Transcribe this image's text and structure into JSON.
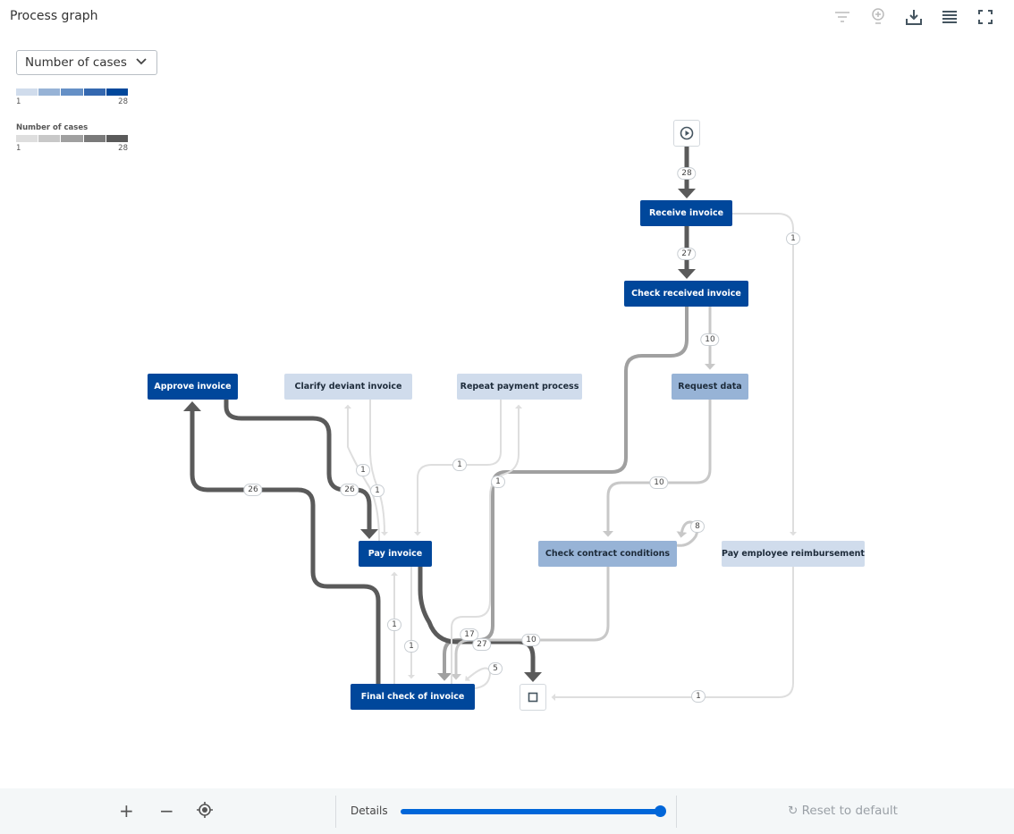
{
  "header": {
    "title": "Process graph",
    "tools": [
      "filter-icon",
      "lightbulb-icon",
      "download-icon",
      "list-icon",
      "fullscreen-icon"
    ]
  },
  "metric_select": {
    "value": "Number of cases"
  },
  "node_legend": {
    "min": "1",
    "max": "28",
    "colors": [
      "#d0dcec",
      "#97b3d6",
      "#6590c6",
      "#3468b0",
      "#00479b"
    ]
  },
  "edge_legend": {
    "title": "Number of cases",
    "min": "1",
    "max": "28",
    "colors": [
      "#dedede",
      "#c8c8c8",
      "#a0a0a0",
      "#7a7a7a",
      "#5a5a5a"
    ]
  },
  "nodes": [
    {
      "id": "receive",
      "label": "Receive invoice",
      "shade": "dark"
    },
    {
      "id": "check_received",
      "label": "Check received invoice",
      "shade": "dark"
    },
    {
      "id": "approve",
      "label": "Approve invoice",
      "shade": "dark"
    },
    {
      "id": "clarify",
      "label": "Clarify deviant invoice",
      "shade": "light"
    },
    {
      "id": "repeat",
      "label": "Repeat payment process",
      "shade": "light"
    },
    {
      "id": "request",
      "label": "Request data",
      "shade": "mid"
    },
    {
      "id": "pay",
      "label": "Pay invoice",
      "shade": "dark"
    },
    {
      "id": "contract",
      "label": "Check contract conditions",
      "shade": "mid"
    },
    {
      "id": "reimburse",
      "label": "Pay employee reimbursement",
      "shade": "light"
    },
    {
      "id": "final",
      "label": "Final check of invoice",
      "shade": "dark"
    }
  ],
  "edges": [
    {
      "from": "start",
      "to": "receive",
      "count": "28"
    },
    {
      "from": "receive",
      "to": "check_received",
      "count": "27"
    },
    {
      "from": "receive",
      "to": "reimburse",
      "count": "1"
    },
    {
      "from": "check_received",
      "to": "request",
      "count": "10"
    },
    {
      "from": "check_received",
      "to": "final",
      "count": "17"
    },
    {
      "from": "approve",
      "to": "pay",
      "count": "26"
    },
    {
      "from": "final",
      "to": "approve",
      "count": "26"
    },
    {
      "from": "clarify",
      "to": "pay",
      "count": "1"
    },
    {
      "from": "pay",
      "to": "clarify",
      "count": "1"
    },
    {
      "from": "pay",
      "to": "end",
      "count": "27"
    },
    {
      "from": "pay",
      "to": "final",
      "count": "1"
    },
    {
      "from": "final",
      "to": "pay",
      "count": "1"
    },
    {
      "from": "request",
      "to": "contract",
      "count": "10"
    },
    {
      "from": "contract",
      "to": "contract",
      "count": "8"
    },
    {
      "from": "contract",
      "to": "final",
      "count": "10"
    },
    {
      "from": "final",
      "to": "final",
      "count": "5"
    },
    {
      "from": "reimburse",
      "to": "end",
      "count": "1"
    },
    {
      "from": "repeat",
      "to": "pay",
      "count": "1"
    },
    {
      "from": "final",
      "to": "repeat",
      "count": "1"
    }
  ],
  "footer": {
    "details_label": "Details",
    "details_level": 100,
    "reset_label": "Reset to default"
  }
}
